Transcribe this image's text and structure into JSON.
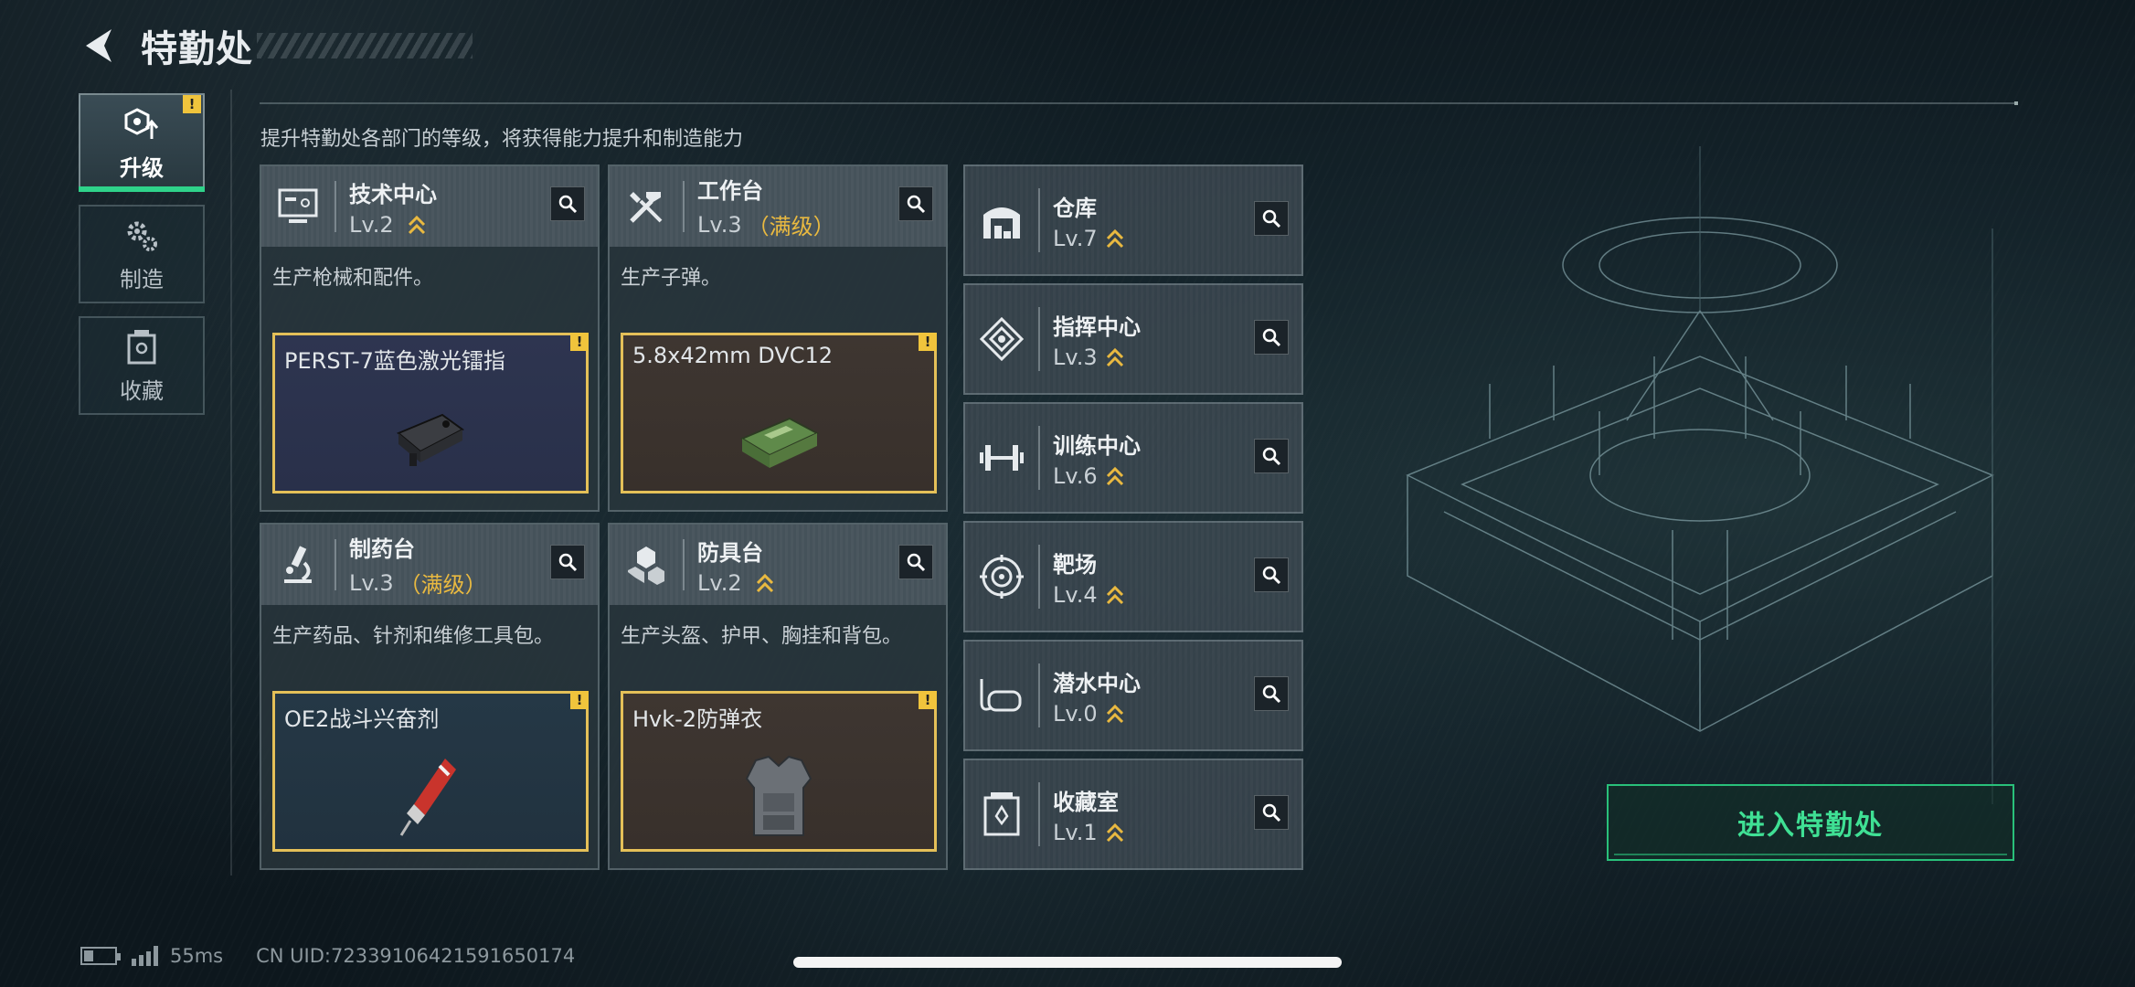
{
  "header": {
    "title": "特勤处"
  },
  "tabs": [
    {
      "label": "升级",
      "icon": "upgrade-icon",
      "active": true,
      "alert": "!"
    },
    {
      "label": "制造",
      "icon": "gears-icon",
      "active": false
    },
    {
      "label": "收藏",
      "icon": "collection-icon",
      "active": false
    }
  ],
  "subtitle": "提升特勤处各部门的等级，将获得能力提升和制造能力",
  "departments": [
    {
      "name": "技术中心",
      "level": "Lv.2",
      "max": "",
      "desc": "生产枪械和配件。",
      "product": "PERST-7蓝色激光镭指",
      "alert": "!"
    },
    {
      "name": "工作台",
      "level": "Lv.3",
      "max": "（满级）",
      "desc": "生产子弹。",
      "product": "5.8x42mm DVC12",
      "alert": "!"
    },
    {
      "name": "制药台",
      "level": "Lv.3",
      "max": "（满级）",
      "desc": "生产药品、针剂和维修工具包。",
      "product": "OE2战斗兴奋剂",
      "alert": "!"
    },
    {
      "name": "防具台",
      "level": "Lv.2",
      "max": "",
      "desc": "生产头盔、护甲、胸挂和背包。",
      "product": "Hvk-2防弹衣",
      "alert": "!"
    }
  ],
  "facilities": [
    {
      "name": "仓库",
      "level": "Lv.7"
    },
    {
      "name": "指挥中心",
      "level": "Lv.3"
    },
    {
      "name": "训练中心",
      "level": "Lv.6"
    },
    {
      "name": "靶场",
      "level": "Lv.4"
    },
    {
      "name": "潜水中心",
      "level": "Lv.0"
    },
    {
      "name": "收藏室",
      "level": "Lv.1"
    }
  ],
  "enter_button": "进入特勤处",
  "status": {
    "ping": "55ms",
    "uid": "CN UID:72339106421591650174"
  },
  "colors": {
    "accent": "#2fd38a",
    "alert": "#f0c43c",
    "max_level": "#e9b940",
    "product_border": "#e4c058"
  }
}
